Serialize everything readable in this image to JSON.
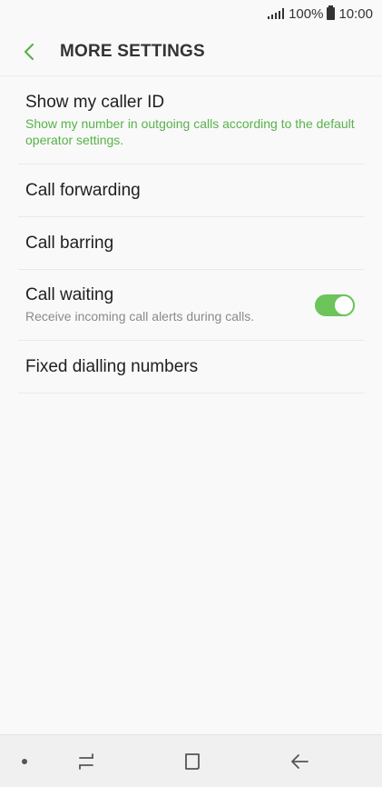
{
  "status_bar": {
    "battery_text": "100%",
    "time": "10:00"
  },
  "header": {
    "title": "MORE SETTINGS"
  },
  "settings": [
    {
      "title": "Show my caller ID",
      "subtitle": "Show my number in outgoing calls according to the default operator settings."
    },
    {
      "title": "Call forwarding"
    },
    {
      "title": "Call barring"
    },
    {
      "title": "Call waiting",
      "subtitle": "Receive incoming call alerts during calls.",
      "toggle_on": true
    },
    {
      "title": "Fixed dialling numbers"
    }
  ],
  "colors": {
    "accent": "#6cc45a",
    "accent_text": "#58b24a",
    "background": "#f9f9f9"
  },
  "icons": {
    "back": "chevron-left-icon",
    "nav_recents": "recents-icon",
    "nav_home": "home-icon",
    "nav_back": "back-arrow-icon"
  }
}
